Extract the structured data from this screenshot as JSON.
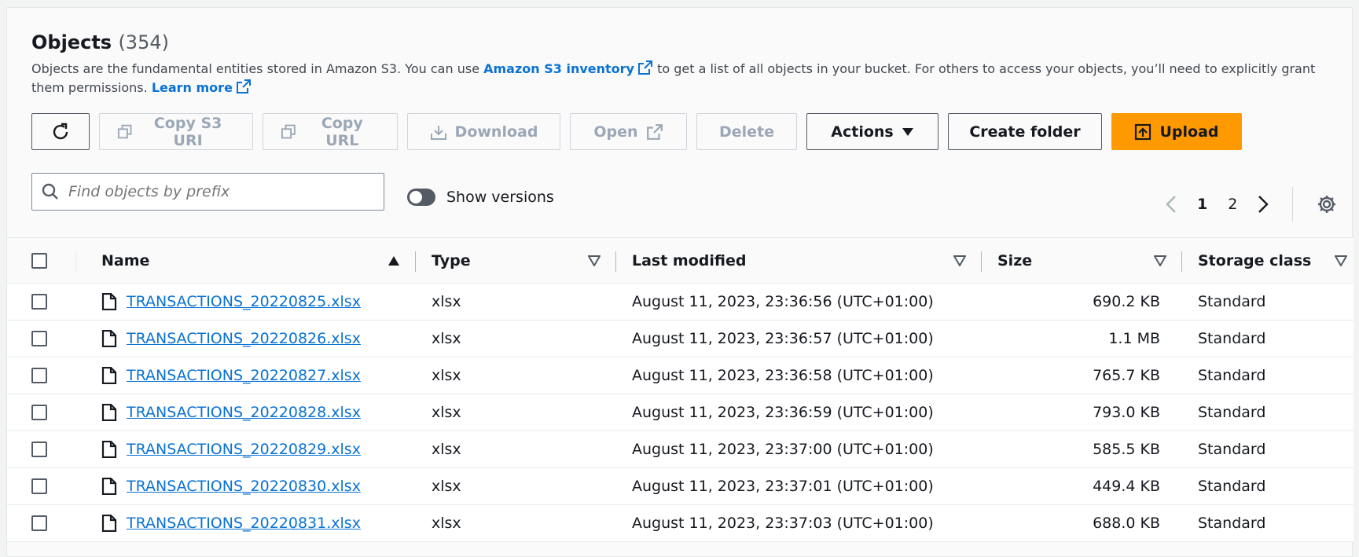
{
  "header": {
    "title": "Objects",
    "count": "(354)",
    "desc_part1": "Objects are the fundamental entities stored in Amazon S3. You can use ",
    "inventory_link": "Amazon S3 inventory",
    "desc_part2": " to get a list of all objects in your bucket. For others to access your objects, you’ll need to explicitly grant them permissions. ",
    "learn_more": "Learn more"
  },
  "toolbar": {
    "copy_s3_uri": "Copy S3 URI",
    "copy_url": "Copy URL",
    "download": "Download",
    "open": "Open",
    "delete": "Delete",
    "actions": "Actions",
    "create_folder": "Create folder",
    "upload": "Upload"
  },
  "search": {
    "placeholder": "Find objects by prefix"
  },
  "versions": {
    "label": "Show versions"
  },
  "pagination": {
    "page1": "1",
    "page2": "2"
  },
  "colors": {
    "accent": "#0972d3",
    "primary": "#ff9900"
  },
  "table": {
    "headers": {
      "name": "Name",
      "type": "Type",
      "modified": "Last modified",
      "size": "Size",
      "class": "Storage class"
    },
    "rows": [
      {
        "name": "TRANSACTIONS_20220825.xlsx",
        "type": "xlsx",
        "modified": "August 11, 2023, 23:36:56 (UTC+01:00)",
        "size": "690.2 KB",
        "class": "Standard"
      },
      {
        "name": "TRANSACTIONS_20220826.xlsx",
        "type": "xlsx",
        "modified": "August 11, 2023, 23:36:57 (UTC+01:00)",
        "size": "1.1 MB",
        "class": "Standard"
      },
      {
        "name": "TRANSACTIONS_20220827.xlsx",
        "type": "xlsx",
        "modified": "August 11, 2023, 23:36:58 (UTC+01:00)",
        "size": "765.7 KB",
        "class": "Standard"
      },
      {
        "name": "TRANSACTIONS_20220828.xlsx",
        "type": "xlsx",
        "modified": "August 11, 2023, 23:36:59 (UTC+01:00)",
        "size": "793.0 KB",
        "class": "Standard"
      },
      {
        "name": "TRANSACTIONS_20220829.xlsx",
        "type": "xlsx",
        "modified": "August 11, 2023, 23:37:00 (UTC+01:00)",
        "size": "585.5 KB",
        "class": "Standard"
      },
      {
        "name": "TRANSACTIONS_20220830.xlsx",
        "type": "xlsx",
        "modified": "August 11, 2023, 23:37:01 (UTC+01:00)",
        "size": "449.4 KB",
        "class": "Standard"
      },
      {
        "name": "TRANSACTIONS_20220831.xlsx",
        "type": "xlsx",
        "modified": "August 11, 2023, 23:37:03 (UTC+01:00)",
        "size": "688.0 KB",
        "class": "Standard"
      }
    ]
  }
}
